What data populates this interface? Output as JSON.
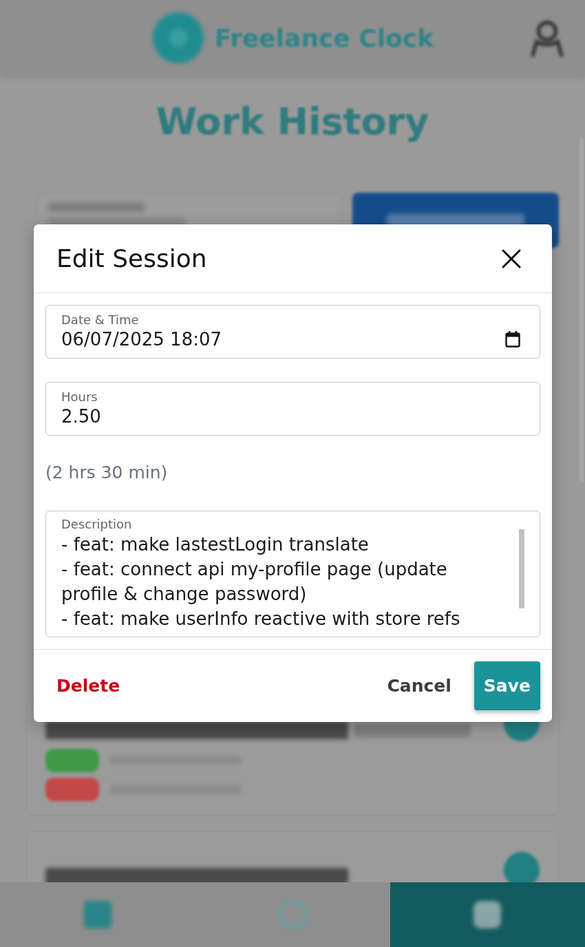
{
  "app_bar": {
    "title": "Freelance Clock"
  },
  "page": {
    "title": "Work History"
  },
  "sessions": [
    {
      "badges": [
        {
          "color": "#3f9a47"
        },
        {
          "color": "#c44848"
        }
      ]
    }
  ],
  "bottom_nav": {
    "items": [
      {
        "kind": "square",
        "selected": false
      },
      {
        "kind": "ring",
        "selected": false
      },
      {
        "kind": "tile",
        "selected": true
      }
    ]
  },
  "dialog": {
    "title": "Edit Session",
    "fields": [
      {
        "kind": "datetime",
        "label": "Date & Time",
        "value": "06/07/2025 18:07"
      },
      {
        "kind": "number",
        "label": "Hours",
        "value": "2.50"
      }
    ],
    "duration_hint": "(2 hrs 30 min)",
    "description": {
      "label": "Description",
      "value": "- feat: make lastestLogin translate\n- feat: connect api my-profile page (update profile & change password)\n- feat: make userInfo reactive with store refs"
    },
    "buttons": [
      {
        "kind": "danger",
        "label": "Delete"
      },
      {
        "kind": "text",
        "label": "Cancel"
      },
      {
        "kind": "primary",
        "label": "Save"
      }
    ]
  }
}
